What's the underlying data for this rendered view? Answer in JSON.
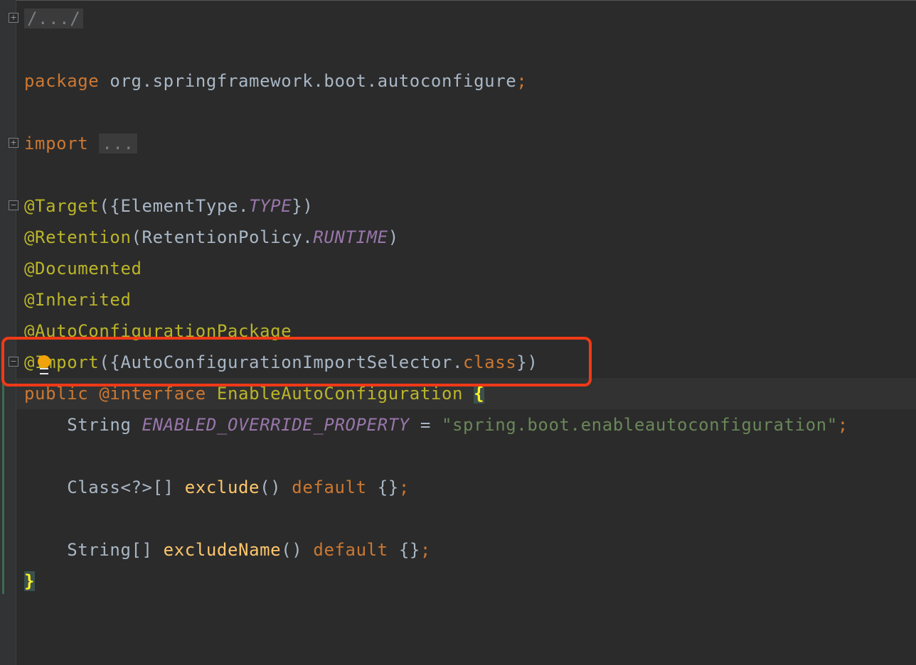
{
  "code": {
    "header_fold": "/.../",
    "package_kw": "package",
    "package_name": "org.springframework.boot.autoconfigure",
    "semicolon": ";",
    "import_kw": "import",
    "import_fold": "...",
    "target": {
      "ann": "@Target",
      "open": "({ElementType.",
      "const": "TYPE",
      "close": "})"
    },
    "retention": {
      "ann": "@Retention",
      "open": "(RetentionPolicy.",
      "const": "RUNTIME",
      "close": ")"
    },
    "documented": "@Documented",
    "inherited": "@Inherited",
    "auto_config_package": "@AutoConfigurationPackage",
    "import_ann": {
      "ann": "@Import",
      "open": "({AutoConfigurationImportSelector.",
      "kw": "class",
      "close": "})"
    },
    "decl": {
      "public": "public",
      "interface": "@interface",
      "name": "EnableAutoConfiguration",
      "brace": "{"
    },
    "field": {
      "type": "String",
      "name": "ENABLED_OVERRIDE_PROPERTY",
      "eq": " = ",
      "value": "\"spring.boot.enableautoconfiguration\"",
      "semi": ";"
    },
    "exclude": {
      "type": "Class<?>[]",
      "method": "exclude",
      "parens": "()",
      "kw": "default",
      "val": "{}",
      "semi": ";"
    },
    "exclude_name": {
      "type": "String[]",
      "method": "excludeName",
      "parens": "()",
      "kw": "default",
      "val": "{}",
      "semi": ";"
    },
    "closing_brace": "}"
  },
  "icons": {
    "fold": "fold-plus-icon",
    "unfold": "fold-minus-icon",
    "intention": "lightbulb-icon"
  },
  "colors": {
    "background": "#2b2b2b",
    "keyword": "#cc7832",
    "annotation": "#bbb529",
    "constant": "#9876aa",
    "string": "#6a8759",
    "method": "#ffc66d",
    "highlight_box": "#f03a17"
  }
}
